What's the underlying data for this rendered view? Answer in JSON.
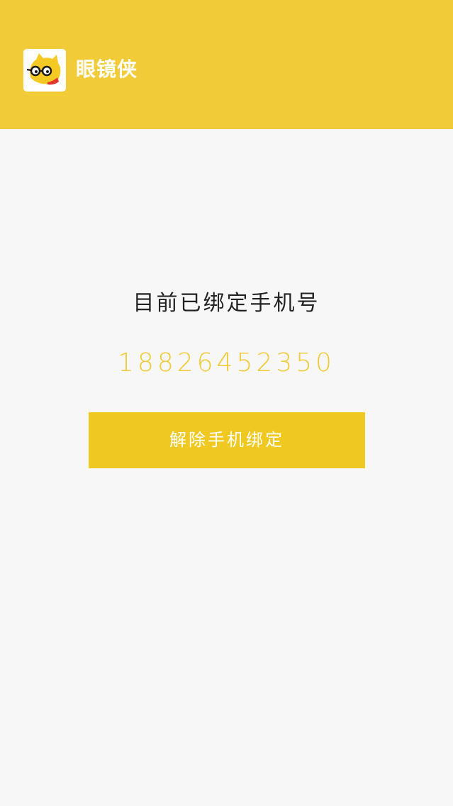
{
  "header": {
    "brand_name": "眼镜侠",
    "logo_icon": "yellow-cat-with-glasses-logo-icon",
    "background_color": "#f2cb39"
  },
  "binding": {
    "label": "目前已绑定手机号",
    "phone_number": "18826452350",
    "phone_color": "#f0c935"
  },
  "actions": {
    "unbind_button_label": "解除手机绑定",
    "button_color": "#f0c822"
  }
}
